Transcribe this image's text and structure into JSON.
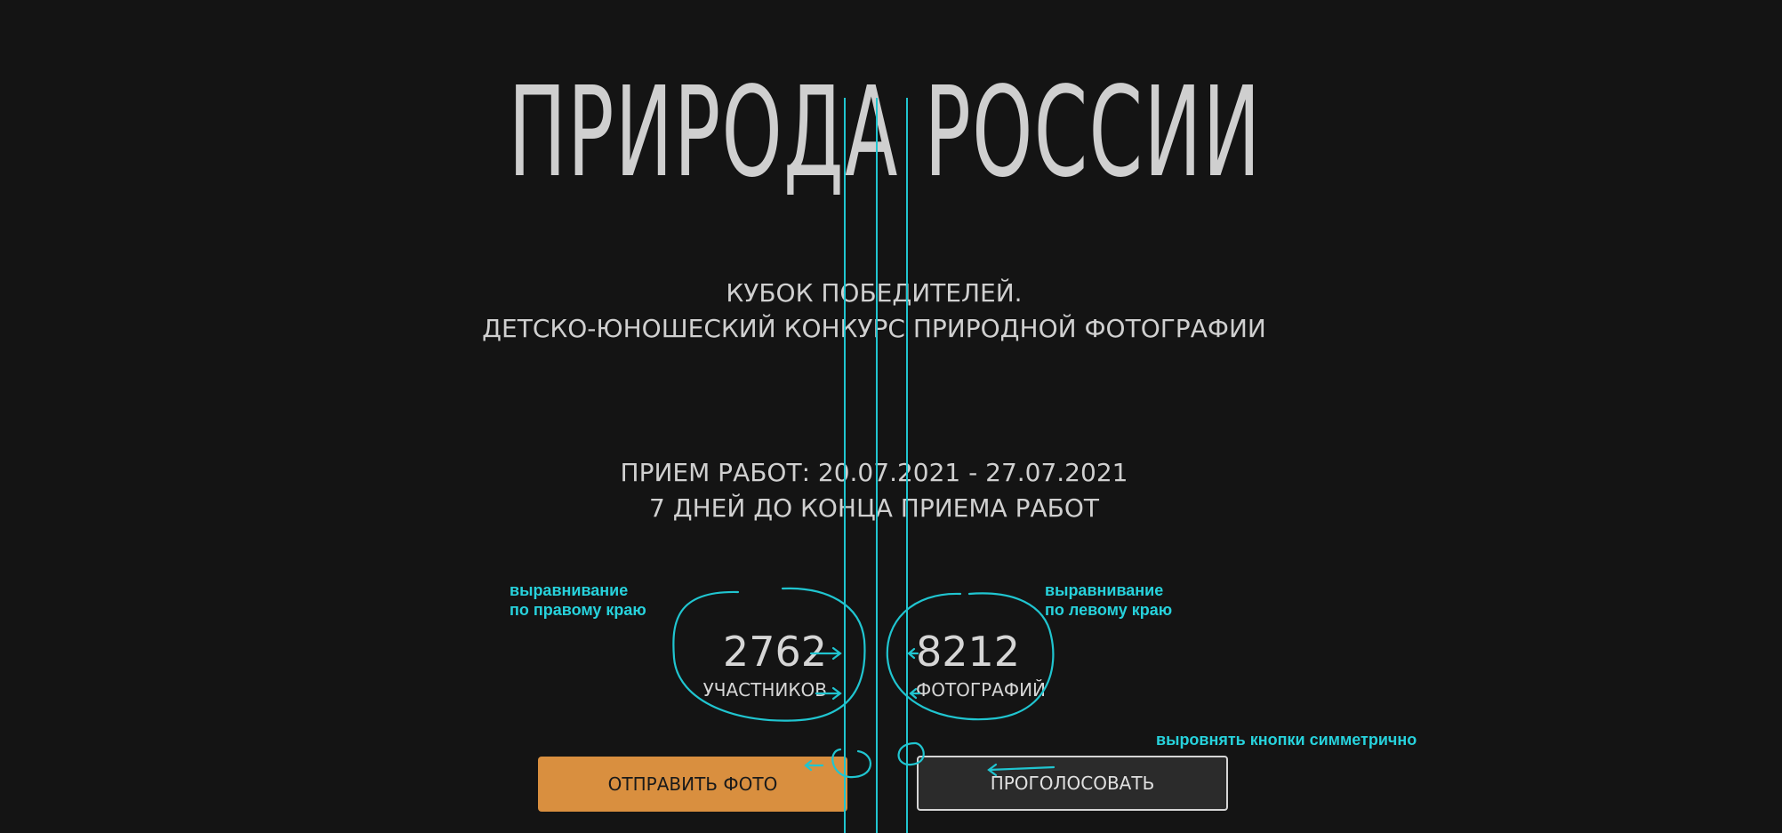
{
  "hero": {
    "title": "ПРИРОДА РОССИИ",
    "subtitle_line1": "КУБОК ПОБЕДИТЕЛЕЙ.",
    "subtitle_line2": "ДЕТСКО-ЮНОШЕСКИЙ КОНКУРС ПРИРОДНОЙ ФОТОГРАФИИ",
    "dates_line1": "ПРИЕМ РАБОТ: 20.07.2021 - 27.07.2021",
    "dates_line2": "7 ДНЕЙ ДО КОНЦА ПРИЕМА РАБОТ"
  },
  "stats": {
    "participants_value": "2762",
    "participants_label": "УЧАСТНИКОВ",
    "photos_value": "8212",
    "photos_label": "ФОТОГРАФИЙ"
  },
  "buttons": {
    "send_photo": "ОТПРАВИТЬ ФОТО",
    "vote": "ПРОГОЛОСОВАТЬ"
  },
  "annotations": {
    "left_note_line1": "выравнивание",
    "left_note_line2": "по правому краю",
    "right_note_line1": "выравнивание",
    "right_note_line2": "по левому краю",
    "buttons_note": "выровнять кнопки симметрично"
  },
  "colors": {
    "background": "#141414",
    "accent_orange": "#d98f3f",
    "annotation_cyan": "#27d2dc"
  }
}
